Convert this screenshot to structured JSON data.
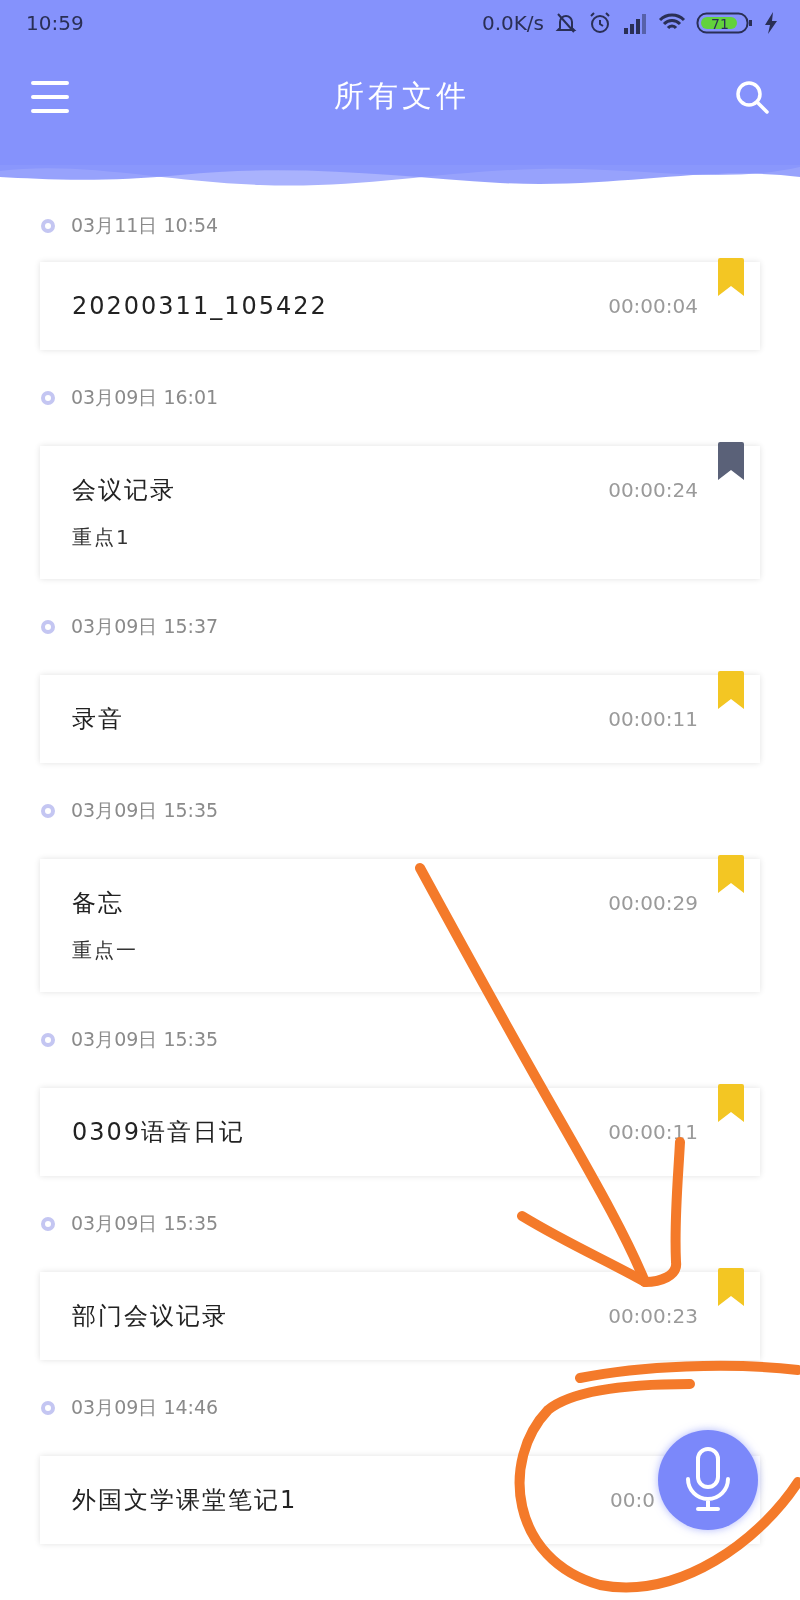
{
  "status_bar": {
    "time": "10:59",
    "net_speed": "0.0K/s",
    "battery": "71"
  },
  "toolbar": {
    "title": "所有文件"
  },
  "recordings": [
    {
      "date": "03月11日 10:54",
      "title": "20200311_105422",
      "duration": "00:00:04",
      "color": "#f3c623"
    },
    {
      "date": "03月09日 16:01",
      "title": "会议记录",
      "note": "重点1",
      "duration": "00:00:24",
      "color": "#5a6178"
    },
    {
      "date": "03月09日 15:37",
      "title": "录音",
      "duration": "00:00:11",
      "color": "#f3c623"
    },
    {
      "date": "03月09日 15:35",
      "title": "备忘",
      "note": "重点一",
      "duration": "00:00:29",
      "color": "#f3c623"
    },
    {
      "date": "03月09日 15:35",
      "title": "0309语音日记",
      "duration": "00:00:11",
      "color": "#f3c623"
    },
    {
      "date": "03月09日 15:35",
      "title": "部门会议记录",
      "duration": "00:00:23",
      "color": "#f3c623"
    },
    {
      "date": "03月09日 14:46",
      "title": "外国文学课堂笔记1",
      "duration": "00:0"
    }
  ]
}
